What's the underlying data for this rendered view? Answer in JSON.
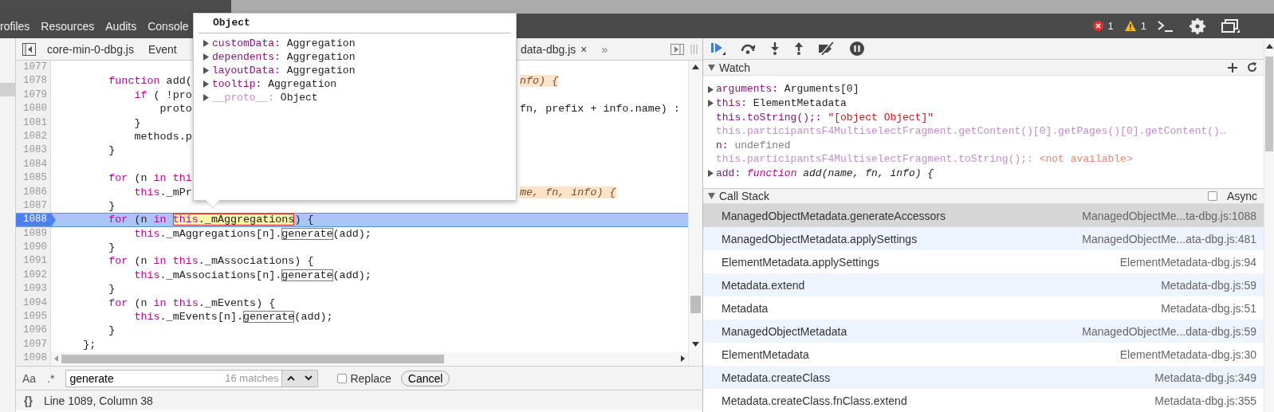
{
  "top_toolbar": {
    "tabs": [
      "rofiles",
      "Resources",
      "Audits",
      "Console"
    ],
    "error_count": "1",
    "warning_count": "1"
  },
  "editor": {
    "tabs": [
      {
        "label": "core-min-0-dbg.js"
      },
      {
        "label": "Event"
      },
      {
        "label": "data-dbg.js",
        "close": "×"
      }
    ],
    "overflow": "»",
    "lines": [
      {
        "number": "1077",
        "current": false
      },
      {
        "number": "1078",
        "current": false,
        "code": [
          {
            "kind": "keyword",
            "text": "        function"
          },
          {
            "kind": "plain",
            "text": " add("
          }
        ],
        "code_right": [
          {
            "kind": "hint",
            "text": "nfo) {"
          }
        ]
      },
      {
        "number": "1079",
        "current": false,
        "code": [
          {
            "kind": "keyword",
            "text": "            if"
          },
          {
            "kind": "plain",
            "text": " ( !pro"
          }
        ]
      },
      {
        "number": "1080",
        "current": false,
        "code": [
          {
            "kind": "plain",
            "text": "                proto"
          }
        ],
        "code_right": [
          {
            "kind": "plain",
            "text": "fn, prefix + info.name) :"
          }
        ]
      },
      {
        "number": "1081",
        "current": false,
        "code": [
          {
            "kind": "plain",
            "text": "            }"
          }
        ]
      },
      {
        "number": "1082",
        "current": false,
        "code": [
          {
            "kind": "plain",
            "text": "            methods.p"
          }
        ]
      },
      {
        "number": "1083",
        "current": false,
        "code": [
          {
            "kind": "plain",
            "text": "        }"
          }
        ]
      },
      {
        "number": "1084",
        "current": false
      },
      {
        "number": "1085",
        "current": false,
        "code": [
          {
            "kind": "keyword",
            "text": "        for"
          },
          {
            "kind": "plain",
            "text": " (n "
          },
          {
            "kind": "keyword",
            "text": "in thi"
          }
        ]
      },
      {
        "number": "1086",
        "current": false,
        "code": [
          {
            "kind": "keyword",
            "text": "            this"
          },
          {
            "kind": "plain",
            "text": "._mPr"
          }
        ],
        "code_right": [
          {
            "kind": "hint",
            "text": "me, fn, info) {"
          }
        ]
      },
      {
        "number": "1087",
        "current": false,
        "code": [
          {
            "kind": "plain",
            "text": "        }"
          }
        ]
      },
      {
        "number": "1088",
        "current": true,
        "code": [
          {
            "kind": "keyword",
            "text": "        for"
          },
          {
            "kind": "plain",
            "text": " (n "
          },
          {
            "kind": "keyword",
            "text": "in "
          },
          {
            "kind": "current-match",
            "parts": [
              {
                "kind": "keyword",
                "text": "this"
              },
              {
                "kind": "plain",
                "text": "._mAggregations"
              }
            ]
          },
          {
            "kind": "plain",
            "text": ") {"
          }
        ]
      },
      {
        "number": "1089",
        "current": false,
        "code": [
          {
            "kind": "keyword",
            "text": "            this"
          },
          {
            "kind": "plain",
            "text": "._mAggregations[n]."
          },
          {
            "kind": "match",
            "text": "generate"
          },
          {
            "kind": "plain",
            "text": "(add);"
          }
        ]
      },
      {
        "number": "1090",
        "current": false,
        "code": [
          {
            "kind": "plain",
            "text": "        }"
          }
        ]
      },
      {
        "number": "1091",
        "current": false,
        "code": [
          {
            "kind": "keyword",
            "text": "        for"
          },
          {
            "kind": "plain",
            "text": " (n "
          },
          {
            "kind": "keyword",
            "text": "in this"
          },
          {
            "kind": "plain",
            "text": "._mAssociations) {"
          }
        ]
      },
      {
        "number": "1092",
        "current": false,
        "code": [
          {
            "kind": "keyword",
            "text": "            this"
          },
          {
            "kind": "plain",
            "text": "._mAssociations[n]."
          },
          {
            "kind": "match",
            "text": "generate"
          },
          {
            "kind": "plain",
            "text": "(add);"
          }
        ]
      },
      {
        "number": "1093",
        "current": false,
        "code": [
          {
            "kind": "plain",
            "text": "        }"
          }
        ]
      },
      {
        "number": "1094",
        "current": false,
        "code": [
          {
            "kind": "keyword",
            "text": "        for"
          },
          {
            "kind": "plain",
            "text": " (n "
          },
          {
            "kind": "keyword",
            "text": "in this"
          },
          {
            "kind": "plain",
            "text": "._mEvents) {"
          }
        ]
      },
      {
        "number": "1095",
        "current": false,
        "code": [
          {
            "kind": "keyword",
            "text": "            this"
          },
          {
            "kind": "plain",
            "text": "._mEvents[n]."
          },
          {
            "kind": "match",
            "text": "generate"
          },
          {
            "kind": "plain",
            "text": "(add);"
          }
        ]
      },
      {
        "number": "1096",
        "current": false,
        "code": [
          {
            "kind": "plain",
            "text": "        }"
          }
        ]
      },
      {
        "number": "1097",
        "current": false,
        "code": [
          {
            "kind": "plain",
            "text": "    };"
          }
        ]
      },
      {
        "number": "1098",
        "current": false
      }
    ],
    "search": {
      "case_toggle": "Aa",
      "regex_toggle": ".*",
      "value": "generate",
      "matches": "16 matches",
      "replace_label": "Replace",
      "replace_checked": false,
      "cancel": "Cancel"
    },
    "status": {
      "pretty_print": "{}",
      "position": "Line 1089, Column 38"
    }
  },
  "popup": {
    "title": "Object",
    "properties": [
      {
        "name": "customData:",
        "value": "Aggregation",
        "kind": "property"
      },
      {
        "name": "dependents:",
        "value": "Aggregation",
        "kind": "property"
      },
      {
        "name": "layoutData:",
        "value": "Aggregation",
        "kind": "property"
      },
      {
        "name": "tooltip:",
        "value": "Aggregation",
        "kind": "property"
      },
      {
        "name": "__proto__:",
        "value": "Object",
        "kind": "internal"
      }
    ]
  },
  "watch": {
    "title": "Watch",
    "expanded": true,
    "items": [
      {
        "name": "arguments:",
        "value": "Arguments[0]",
        "expandable": true,
        "kind": "object"
      },
      {
        "name": "this:",
        "value": "ElementMetadata",
        "expandable": true,
        "kind": "object"
      },
      {
        "name": "this.toString();:",
        "value": "\"[object Object]\"",
        "expandable": false,
        "kind": "string"
      },
      {
        "name": "this.participantsF4MultiselectFragment.getContent()[0].getPages()[0].getContent()…",
        "expandable": false,
        "kind": "truncated"
      },
      {
        "name": "n:",
        "value": "undefined",
        "expandable": false,
        "kind": "undefined"
      },
      {
        "name": "this.participantsF4MultiselectFragment.toString();:",
        "value": "<not available>",
        "expandable": false,
        "kind": "unavailable"
      },
      {
        "name": "add:",
        "keyword": "function",
        "value": "add(name, fn, info) {",
        "expandable": true,
        "kind": "function"
      }
    ]
  },
  "call_stack": {
    "title": "Call Stack",
    "expanded": true,
    "async_label": "Async",
    "async_checked": false,
    "frames": [
      {
        "function": "ManagedObjectMetadata.generateAccessors",
        "location": "ManagedObjectMe...ta-dbg.js:1088",
        "selected": true
      },
      {
        "function": "ManagedObjectMetadata.applySettings",
        "location": "ManagedObjectMe...ata-dbg.js:481",
        "selected": false
      },
      {
        "function": "ElementMetadata.applySettings",
        "location": "ElementMetadata-dbg.js:94",
        "selected": false
      },
      {
        "function": "Metadata.extend",
        "location": "Metadata-dbg.js:59",
        "selected": false
      },
      {
        "function": "Metadata",
        "location": "Metadata-dbg.js:51",
        "selected": false
      },
      {
        "function": "ManagedObjectMetadata",
        "location": "ManagedObjectMe...data-dbg.js:59",
        "selected": false
      },
      {
        "function": "ElementMetadata",
        "location": "ElementMetadata-dbg.js:30",
        "selected": false
      },
      {
        "function": "Metadata.createClass",
        "location": "Metadata-dbg.js:349",
        "selected": false
      },
      {
        "function": "Metadata.createClass.fnClass.extend",
        "location": "Metadata-dbg.js:355",
        "selected": false
      }
    ]
  }
}
